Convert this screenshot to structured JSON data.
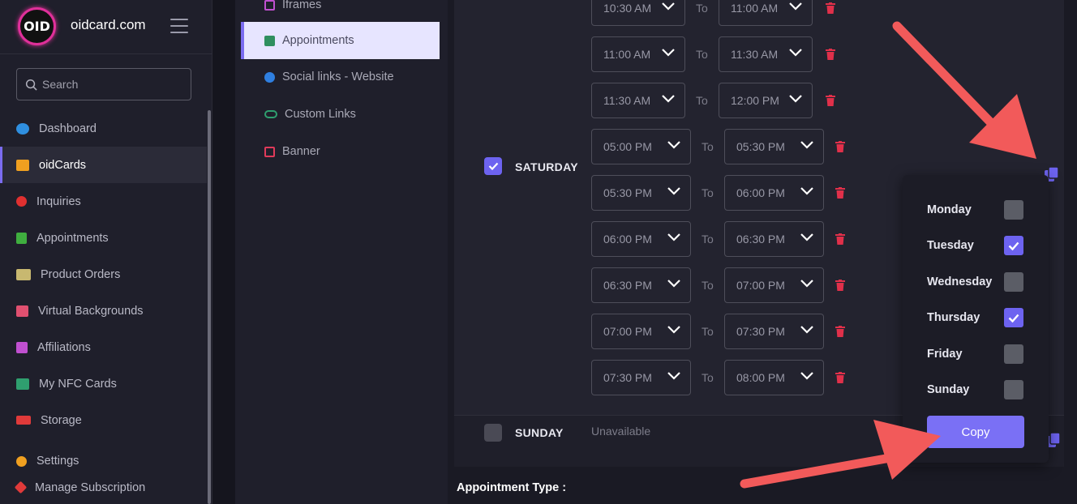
{
  "brand": {
    "logo_text": "OID",
    "site_name": "oidcard.com"
  },
  "search": {
    "placeholder": "Search"
  },
  "sidebar": {
    "items": [
      {
        "label": "Dashboard",
        "color": "#2f8fe0"
      },
      {
        "label": "oidCards",
        "color": "#f0a020"
      },
      {
        "label": "Inquiries",
        "color": "#e03030"
      },
      {
        "label": "Appointments",
        "color": "#3fae3f"
      },
      {
        "label": "Product Orders",
        "color": "#c8b870"
      },
      {
        "label": "Virtual Backgrounds",
        "color": "#e05070"
      },
      {
        "label": "Affiliations",
        "color": "#c050d0"
      },
      {
        "label": "My NFC Cards",
        "color": "#2f9f6f"
      },
      {
        "label": "Storage",
        "color": "#e03a3a"
      },
      {
        "label": "Settings",
        "color": "#f0a020"
      },
      {
        "label": "Manage Subscription",
        "color": "#e03a3a"
      }
    ]
  },
  "subnav": {
    "items": [
      {
        "label": "Iframes",
        "color": "#c050d0"
      },
      {
        "label": "Appointments",
        "color": "#2f8f5f"
      },
      {
        "label": "Social links - Website",
        "color": "#2f7fe0"
      },
      {
        "label": "Custom Links",
        "color": "#2f9f6f"
      },
      {
        "label": "Banner",
        "color": "#e03a5a"
      }
    ]
  },
  "schedule": {
    "to_label": "To",
    "saturday": {
      "label": "SATURDAY",
      "checked": true,
      "slots": [
        {
          "from": "10:30 AM",
          "to": "11:00 AM"
        },
        {
          "from": "11:00 AM",
          "to": "11:30 AM"
        },
        {
          "from": "11:30 AM",
          "to": "12:00 PM"
        },
        {
          "from": "05:00 PM",
          "to": "05:30 PM"
        },
        {
          "from": "05:30 PM",
          "to": "06:00 PM"
        },
        {
          "from": "06:00 PM",
          "to": "06:30 PM"
        },
        {
          "from": "06:30 PM",
          "to": "07:00 PM"
        },
        {
          "from": "07:00 PM",
          "to": "07:30 PM"
        },
        {
          "from": "07:30 PM",
          "to": "08:00 PM"
        }
      ]
    },
    "sunday": {
      "label": "SUNDAY",
      "checked": false,
      "status": "Unavailable"
    }
  },
  "appointment_type_label": "Appointment Type :",
  "copy_popup": {
    "days": [
      {
        "label": "Monday",
        "checked": false
      },
      {
        "label": "Tuesday",
        "checked": true
      },
      {
        "label": "Wednesday",
        "checked": false
      },
      {
        "label": "Thursday",
        "checked": true
      },
      {
        "label": "Friday",
        "checked": false
      },
      {
        "label": "Sunday",
        "checked": false
      }
    ],
    "button_label": "Copy"
  },
  "colors": {
    "accent": "#7a70f5",
    "danger": "#e0304a",
    "annotation_arrow": "#f25a5a"
  }
}
